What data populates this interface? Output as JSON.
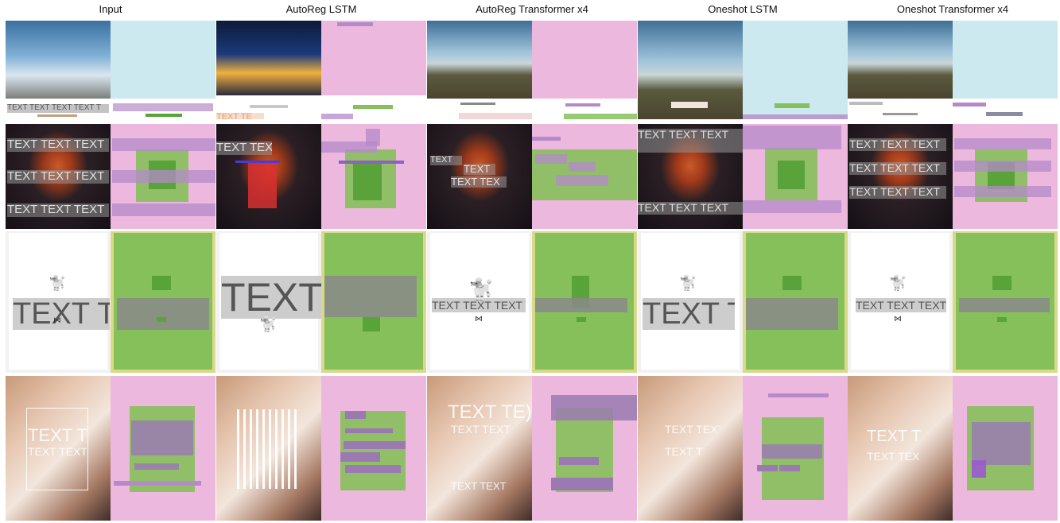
{
  "columns": [
    {
      "header": "Input"
    },
    {
      "header": "AutoReg LSTM"
    },
    {
      "header": "AutoReg Transformer x4"
    },
    {
      "header": "Oneshot LSTM"
    },
    {
      "header": "Oneshot Transformer x4"
    }
  ],
  "overlay_text": {
    "row1_input": "TEXT TEXT TEXT TEXT T",
    "row1_lstm": "TEXT TE",
    "row2_line": "TEXT TEXT TEXT",
    "row2_line_short": "TEXT TEXT",
    "row2_autoreg_transformer_a": "TEXT",
    "row2_autoreg_transformer_b": "TEXT TEX",
    "row2_oneshot_transformer": "TEXT TEXT TEXT",
    "row3_big": "TEXT TE",
    "row3_big_lstm": "TEXT T",
    "row3_small": "TEXT TEXT TEXT T",
    "row4_a": "TEXT TI",
    "row4_b": "TEXT TEXT",
    "row4_c": "TEXT TE)",
    "row4_d": "TEXT TEXT",
    "row4_e": "TEXT T",
    "row4_f": "TEXT TEX",
    "row4_g": "TEXT TEXT"
  },
  "colors": {
    "pink": "#edb8de",
    "lightblue": "#cde9f0",
    "green": "#86c05a",
    "green_dark": "#5aa33a",
    "purple": "#b48ac9",
    "gray": "#9b9b9b",
    "yellow_border": "#d9d98a"
  },
  "icons": {
    "dog": "poodle-icon",
    "bow": "bow-tie-icon"
  }
}
